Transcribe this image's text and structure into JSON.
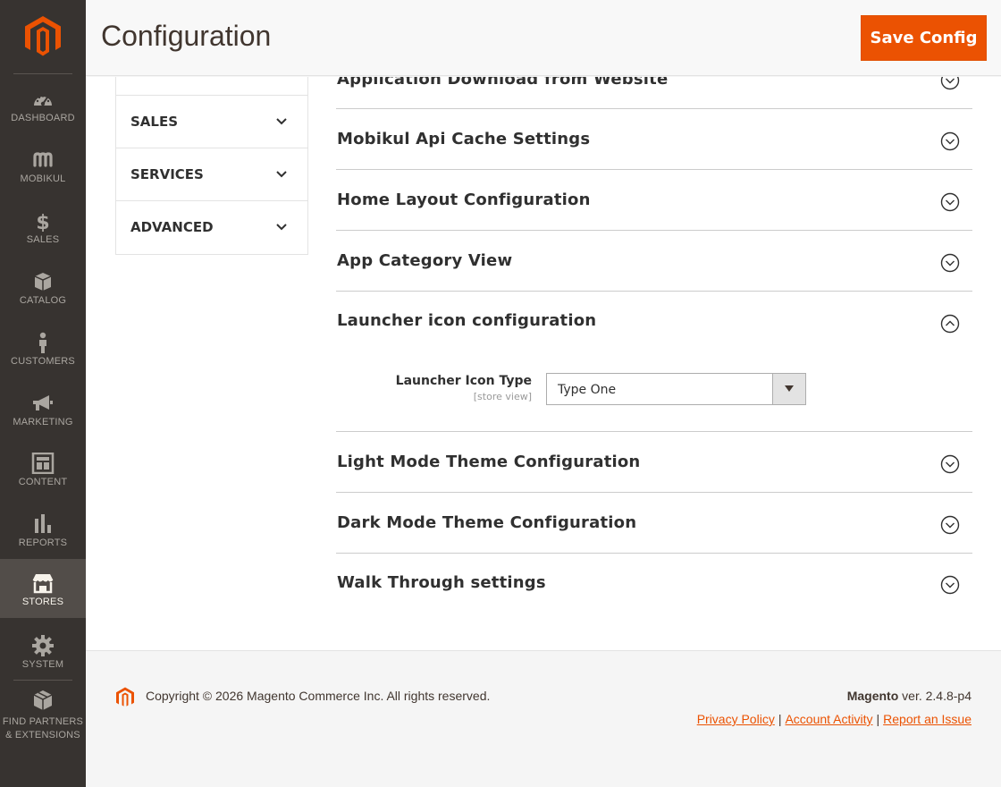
{
  "sidebar": {
    "items": [
      {
        "label": "DASHBOARD",
        "icon": "dashboard-icon"
      },
      {
        "label": "MOBIKUL",
        "icon": "mobikul-icon"
      },
      {
        "label": "SALES",
        "icon": "dollar-icon"
      },
      {
        "label": "CATALOG",
        "icon": "box-icon"
      },
      {
        "label": "CUSTOMERS",
        "icon": "person-icon"
      },
      {
        "label": "MARKETING",
        "icon": "megaphone-icon"
      },
      {
        "label": "CONTENT",
        "icon": "layout-icon"
      },
      {
        "label": "REPORTS",
        "icon": "bar-chart-icon"
      },
      {
        "label": "STORES",
        "icon": "store-icon",
        "active": true
      },
      {
        "label": "SYSTEM",
        "icon": "gear-icon"
      },
      {
        "label_line1": "FIND PARTNERS",
        "label_line2": "& EXTENSIONS",
        "icon": "extensions-icon"
      }
    ]
  },
  "header": {
    "title": "Configuration",
    "save_label": "Save Config"
  },
  "tabs": [
    {
      "label": "SALES"
    },
    {
      "label": "SERVICES"
    },
    {
      "label": "ADVANCED"
    }
  ],
  "sections": [
    {
      "title": "Application Download from Website",
      "expanded": false
    },
    {
      "title": "Mobikul Api Cache Settings",
      "expanded": false
    },
    {
      "title": "Home Layout Configuration",
      "expanded": false
    },
    {
      "title": "App Category View",
      "expanded": false
    },
    {
      "title": "Launcher icon configuration",
      "expanded": true
    },
    {
      "title": "Light Mode Theme Configuration",
      "expanded": false
    },
    {
      "title": "Dark Mode Theme Configuration",
      "expanded": false
    },
    {
      "title": "Walk Through settings",
      "expanded": false
    }
  ],
  "launcher_field": {
    "label": "Launcher Icon Type",
    "scope": "[store view]",
    "value": "Type One"
  },
  "footer": {
    "copyright": "Copyright © 2026 Magento Commerce Inc. All rights reserved.",
    "brand": "Magento",
    "version": " ver. 2.4.8-p4",
    "links": [
      "Privacy Policy",
      "Account Activity",
      "Report an Issue"
    ]
  },
  "colors": {
    "accent": "#eb5202",
    "sidebar_bg": "#373330",
    "sidebar_active": "#524d49"
  }
}
